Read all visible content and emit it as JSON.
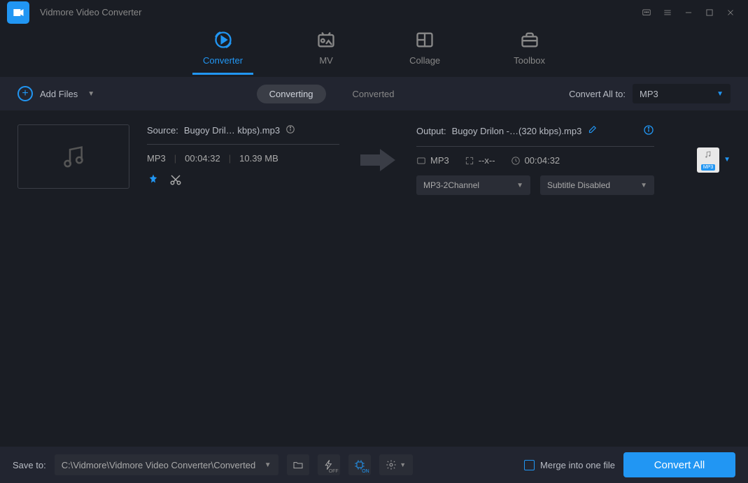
{
  "app": {
    "title": "Vidmore Video Converter"
  },
  "nav": {
    "converter": "Converter",
    "mv": "MV",
    "collage": "Collage",
    "toolbox": "Toolbox"
  },
  "toolbar": {
    "add_files": "Add Files",
    "state_converting": "Converting",
    "state_converted": "Converted",
    "convert_all_to": "Convert All to:",
    "format": "MP3"
  },
  "item": {
    "source_prefix": "Source:",
    "source_name": "Bugoy Dril… kbps).mp3",
    "src_format": "MP3",
    "src_duration": "00:04:32",
    "src_size": "10.39 MB",
    "output_prefix": "Output:",
    "output_name": "Bugoy Drilon -…(320 kbps).mp3",
    "out_format": "MP3",
    "out_resolution": "--x--",
    "out_duration": "00:04:32",
    "audio_select": "MP3-2Channel",
    "subtitle_select": "Subtitle Disabled",
    "fmt_badge": "MP3"
  },
  "bottom": {
    "save_to": "Save to:",
    "path": "C:\\Vidmore\\Vidmore Video Converter\\Converted",
    "hw_on": "ON",
    "flash_off": "OFF",
    "merge": "Merge into one file",
    "convert_all": "Convert All"
  }
}
